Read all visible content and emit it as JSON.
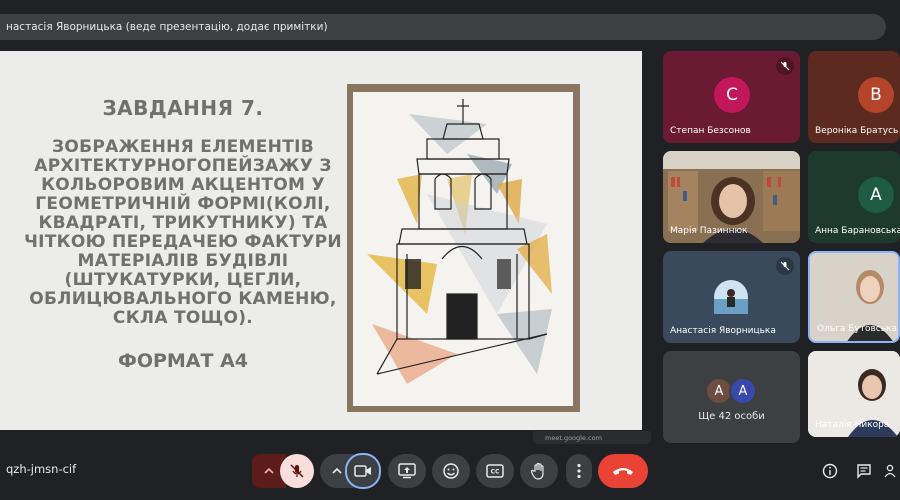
{
  "presenter_bar": {
    "text": "настасія Яворницька (веде презентацію, додає примітки)"
  },
  "slide": {
    "title": "ЗАВДАННЯ 7.",
    "body": "ЗОБРАЖЕННЯ ЕЛЕМЕНТІВ АРХІТЕКТУРНОГОПЕЙЗАЖУ З КОЛЬОРОВИМ АКЦЕНТОМ У ГЕОМЕТРИЧНІЙ ФОРМІ(КОЛІ, КВАДРАТІ, ТРИКУТНИКУ) ТА ЧІТКОЮ ПЕРЕДАЧЕЮ ФАКТУРИ МАТЕРІАЛІВ БУДІВЛІ (ШТУКАТУРКИ, ЦЕГЛИ, ОБЛИЦЮВАЛЬНОГО КАМЕНЮ, СКЛА ТОЩО).",
    "format": "ФОРМАТ А4",
    "url_chip": "meet.google.com"
  },
  "participants": [
    {
      "name": "Степан Безсонов",
      "initial": "C",
      "tile_color": "#6b1a33",
      "avatar_color": "#c2185b",
      "muted": true
    },
    {
      "name": "Вероніка Братусь",
      "initial": "B",
      "tile_color": "#5c2a1e",
      "avatar_color": "#b5452a",
      "muted": false
    },
    {
      "name": "Марія Пазиннюк",
      "type": "video",
      "muted": false
    },
    {
      "name": "Анна Барановська",
      "initial": "A",
      "tile_color": "#1e3a2e",
      "avatar_color": "#1f5c45",
      "muted": false
    },
    {
      "name": "Анастасія Яворницька",
      "type": "photo",
      "tile_color": "#3a4a5c",
      "muted": true
    },
    {
      "name": "Ольга Бутовська",
      "type": "video",
      "muted": false
    },
    {
      "name": "Ще 42 особи",
      "stack": [
        "A",
        "A"
      ]
    },
    {
      "name": "Наталія Никора",
      "type": "video",
      "muted": false
    }
  ],
  "bottom_bar": {
    "meeting_code": "qzh-jmsn-cif",
    "buttons": [
      "mic-options",
      "mic-muted",
      "camera-options",
      "camera",
      "present",
      "emoji",
      "captions",
      "raise-hand",
      "more",
      "leave-call"
    ],
    "right_icons": [
      "info",
      "chat",
      "people"
    ]
  },
  "colors": {
    "accent_red": "#ea4335",
    "control_bg": "#3c4043",
    "background": "#202124"
  }
}
